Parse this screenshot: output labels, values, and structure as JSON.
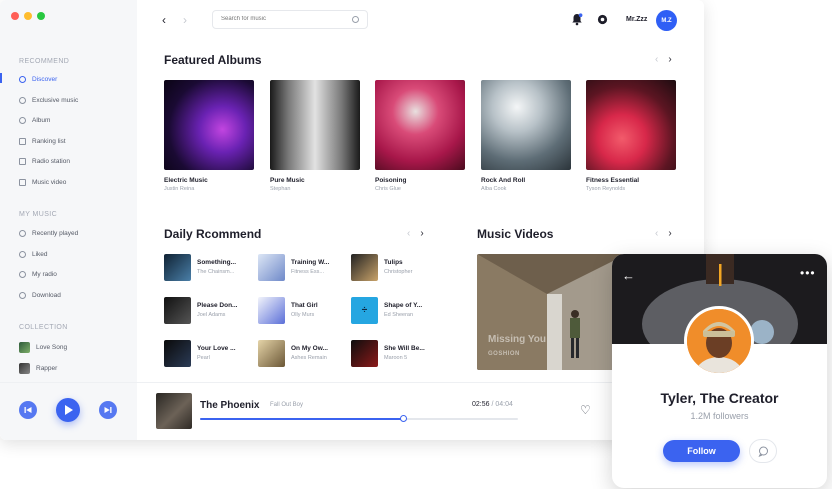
{
  "search": {
    "placeholder": "Search for music"
  },
  "user": {
    "name": "Mr.Zzz",
    "initials": "M.Z"
  },
  "sidebar": {
    "recommend_title": "RECOMMEND",
    "recommend": [
      {
        "label": "Discover",
        "active": true
      },
      {
        "label": "Exclusive music"
      },
      {
        "label": "Album"
      },
      {
        "label": "Ranking list"
      },
      {
        "label": "Radio station"
      },
      {
        "label": "Music video"
      }
    ],
    "mymusic_title": "MY MUSIC",
    "mymusic": [
      {
        "label": "Recently played"
      },
      {
        "label": "Liked"
      },
      {
        "label": "My radio"
      },
      {
        "label": "Download"
      }
    ],
    "collection_title": "COLLECTION",
    "collection": [
      {
        "label": "Love Song"
      },
      {
        "label": "Rapper"
      }
    ]
  },
  "featured": {
    "title": "Featured Albums",
    "albums": [
      {
        "title": "Electric Music",
        "artist": "Justin Reina"
      },
      {
        "title": "Pure Music",
        "artist": "Stephan"
      },
      {
        "title": "Poisoning",
        "artist": "Chris Glue"
      },
      {
        "title": "Rock And Roll",
        "artist": "Alba Cook"
      },
      {
        "title": "Fitness Essential",
        "artist": "Tyson Reynolds"
      }
    ]
  },
  "daily": {
    "title": "Daily Rcommend",
    "songs": [
      {
        "title": "Something...",
        "artist": "The Chainsm..."
      },
      {
        "title": "Training W...",
        "artist": "Fitness Ess..."
      },
      {
        "title": "Tulips",
        "artist": "Christopher"
      },
      {
        "title": "Please Don...",
        "artist": "Joel Adams"
      },
      {
        "title": "That Girl",
        "artist": "Olly Murs"
      },
      {
        "title": "Shape of Y...",
        "artist": "Ed Sheeran"
      },
      {
        "title": "Your Love ...",
        "artist": "Pearl"
      },
      {
        "title": "On My Ow...",
        "artist": "Ashes Remain"
      },
      {
        "title": "She Will Be...",
        "artist": "Maroon 5"
      }
    ]
  },
  "videos": {
    "title": "Music Videos",
    "items": [
      {
        "title": "Missing You",
        "artist": "GOSHION"
      }
    ]
  },
  "player": {
    "title": "The Phoenix",
    "artist": "Fall Out Boy",
    "current": "02:56",
    "separator": "/",
    "total": "04:04",
    "progress": 0.64
  },
  "profile": {
    "name": "Tyler, The Creator",
    "followers": "1.2M followers",
    "follow_label": "Follow"
  },
  "colors": {
    "accent": "#3b63f0",
    "close": "#ff5f57",
    "minimize": "#febc2e",
    "maximize": "#28c840"
  }
}
